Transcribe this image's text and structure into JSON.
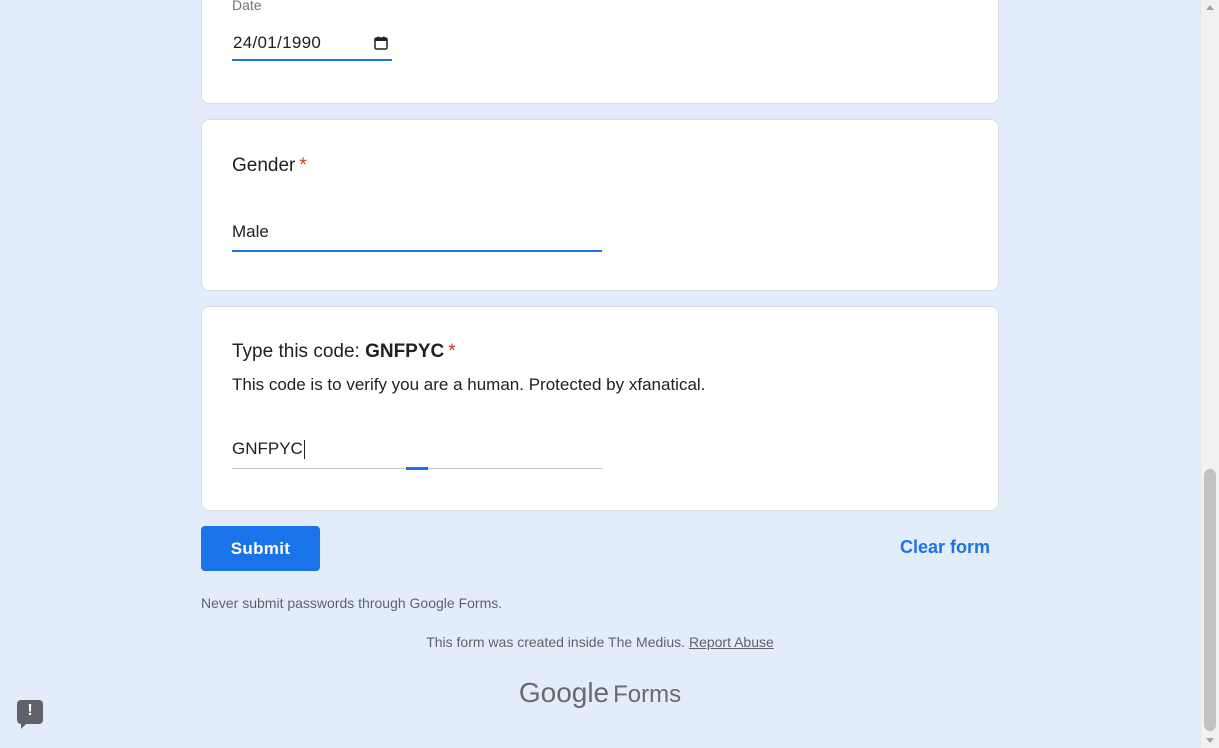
{
  "date_question": {
    "field_label": "Date",
    "value": "24/01/1990"
  },
  "gender_question": {
    "title": "Gender",
    "required_mark": "*",
    "answer": "Male"
  },
  "code_question": {
    "title_prefix": "Type this code: ",
    "code": "GNFPYC",
    "required_mark": "*",
    "description": "This code is to verify you are a human. Protected by xfanatical.",
    "answer": "GNFPYC"
  },
  "actions": {
    "submit_label": "Submit",
    "clear_label": "Clear form"
  },
  "footer": {
    "warning": "Never submit passwords through Google Forms.",
    "created_text": "This form was created inside The Medius. ",
    "report_abuse": "Report Abuse",
    "logo_google": "Google",
    "logo_forms": "Forms"
  },
  "feedback": {
    "icon": "!"
  },
  "colors": {
    "background": "#e3ecfb",
    "accent": "#1a73e8",
    "required": "#d93025"
  }
}
